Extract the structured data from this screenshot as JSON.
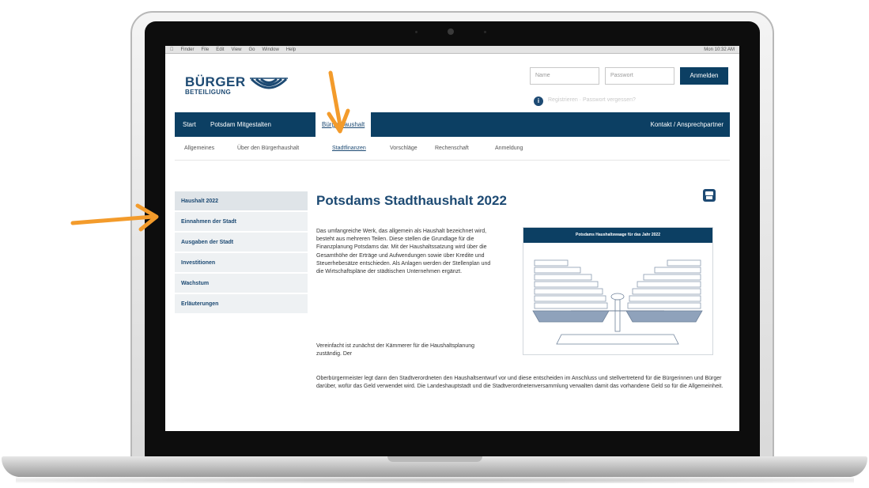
{
  "macos_menubar": {
    "items": [
      "Finder",
      "File",
      "Edit",
      "View",
      "Go",
      "Window",
      "Help"
    ],
    "right_status": "Mon 10:32 AM"
  },
  "site": {
    "logo": {
      "title": "BÜRGER",
      "subtitle": "BETEILIGUNG"
    },
    "login": {
      "name_placeholder": "Name",
      "password_placeholder": "Passwort",
      "button": "Anmelden",
      "register_text": "Registrieren · Passwort vergessen?"
    },
    "main_nav": {
      "items": [
        "Start",
        "Potsdam Mitgestalten",
        "Bürgerhaushalt"
      ],
      "contact": "Kontakt / Ansprechpartner"
    },
    "sub_nav": {
      "items": [
        "Allgemeines",
        "Über den Bürgerhaushalt",
        "Stadtfinanzen",
        "Vorschläge",
        "Rechenschaft",
        "Anmeldung"
      ]
    },
    "sidebar": {
      "items": [
        "Haushalt 2022",
        "Einnahmen der Stadt",
        "Ausgaben der Stadt",
        "Investitionen",
        "Wachstum",
        "Erläuterungen"
      ]
    },
    "content": {
      "title": "Potsdams Stadthaushalt 2022",
      "paragraph1": "Das umfangreiche Werk, das allgemein als Haushalt bezeichnet wird, besteht aus mehreren Teilen. Diese stellen die Grundlage für die Finanzplanung Potsdams dar. Mit der Haushaltssatzung wird über die Gesamthöhe der Erträge und Aufwendungen sowie über Kredite und Steuerhebesätze entschieden. Als Anlagen werden der Stellenplan und die Wirtschaftspläne der städtischen Unternehmen ergänzt.",
      "paragraph2": "Vereinfacht ist zunächst der Kämmerer für die Haushaltsplanung zuständig. Der",
      "paragraph3": "Oberbürgermeister legt dann den Stadtverordneten den Haushaltsentwurf vor und diese entscheiden im Anschluss und stellvertretend für die Bürgerinnen und Bürger darüber, wofür das Geld verwendet wird. Die Landeshauptstadt und die Stadtverordnetenversammlung verwalten damit das vorhandene Geld so für die Allgemeinheit.",
      "infographic_title": "Potsdams Haushaltswaage für das Jahr 2022"
    }
  },
  "colors": {
    "primary": "#0c3f63",
    "sidebar_bg": "#eef1f3",
    "arrow": "#f39b2b"
  }
}
